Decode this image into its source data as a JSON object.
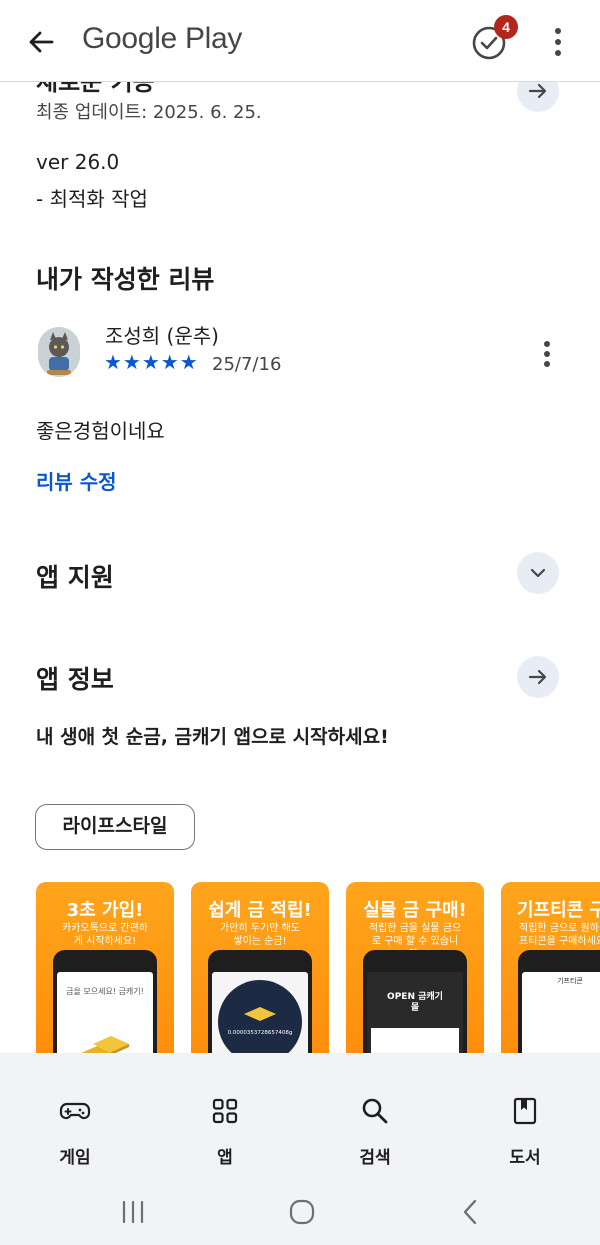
{
  "appbar": {
    "brand": "Google Play",
    "badge_count": "4"
  },
  "whats_new": {
    "partial_title": "새로운 기능",
    "updated": "최종 업데이트: 2025. 6. 25.",
    "version": "ver 26.0",
    "note": "- 최적화 작업"
  },
  "my_review": {
    "title": "내가 작성한 리뷰",
    "reviewer": "조성희 (운추)",
    "stars": "★★★★★",
    "date": "25/7/16",
    "text": "좋은경험이네요",
    "edit_label": "리뷰 수정"
  },
  "app_support": {
    "title": "앱 지원"
  },
  "app_info": {
    "title": "앱 정보",
    "tagline": "내 생애 첫 순금, 금캐기 앱으로 시작하세요!",
    "category_chip": "라이프스타일"
  },
  "screenshots": [
    {
      "title": "3초 가입!",
      "subtitle": "카카오톡으로 간편하게 시작하세요!",
      "screen_text": "금을 모으세요! 금캐기!"
    },
    {
      "title": "쉽게 금 적립!",
      "subtitle": "가만히 두기만 해도 쌓이는 순금!",
      "screen_text": "0.0000353728657408g"
    },
    {
      "title": "실물 금 구매!",
      "subtitle": "적립한 금을 실물 금으로 구매 할 수 있습니다.",
      "screen_text": "OPEN 금캐기 몰"
    },
    {
      "title": "기프티콘 구",
      "subtitle": "적립한 금으로 원하는 기프티콘을 구매하세요",
      "screen_text": "기프티콘"
    }
  ],
  "bottom_nav": {
    "items": [
      {
        "label": "게임",
        "icon": "gamepad-icon"
      },
      {
        "label": "앱",
        "icon": "apps-grid-icon"
      },
      {
        "label": "검색",
        "icon": "search-icon"
      },
      {
        "label": "도서",
        "icon": "book-icon"
      }
    ]
  },
  "colors": {
    "accent_blue": "#0b57d0",
    "badge_red": "#b3261e",
    "screenshot_orange": "#ff9a12",
    "circle_button_bg": "#e8edf5",
    "nav_bg": "#f2f3f7"
  }
}
